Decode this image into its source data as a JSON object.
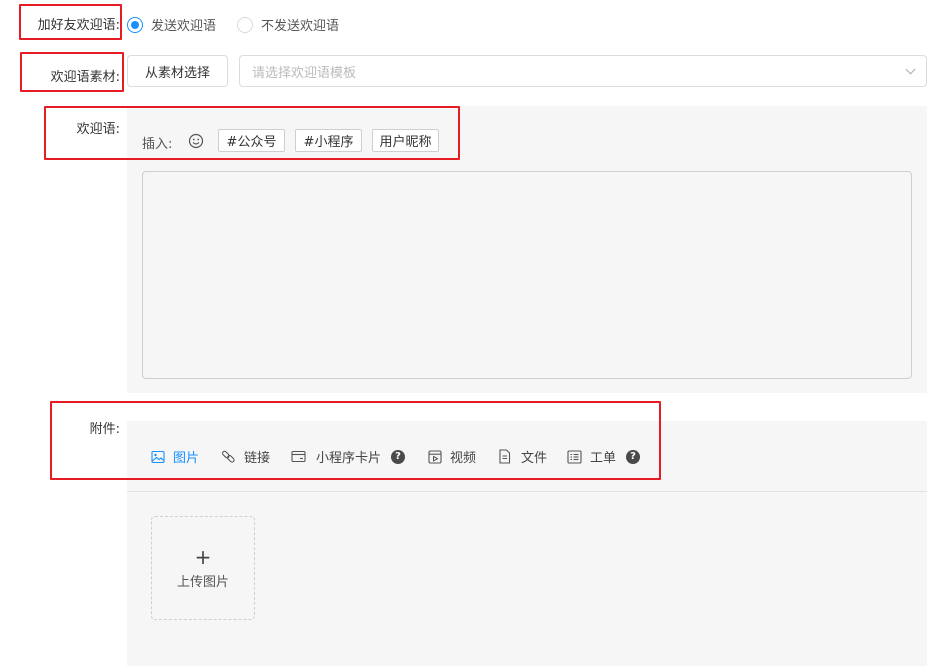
{
  "form": {
    "welcome_toggle": {
      "label": "加好友欢迎语:",
      "options": [
        "发送欢迎语",
        "不发送欢迎语"
      ],
      "selected": "发送欢迎语"
    },
    "material": {
      "label": "欢迎语素材:",
      "pick_button": "从素材选择",
      "select_placeholder": "请选择欢迎语模板"
    },
    "welcome_text": {
      "label": "欢迎语:",
      "insert_label": "插入:",
      "tags": [
        "#公众号",
        "#小程序",
        "用户昵称"
      ],
      "value": ""
    },
    "attachments": {
      "label": "附件:",
      "items": [
        {
          "label": "图片",
          "icon": "image-icon",
          "active": true
        },
        {
          "label": "链接",
          "icon": "link-icon",
          "active": false
        },
        {
          "label": "小程序卡片",
          "icon": "card-icon",
          "active": false,
          "help": true
        },
        {
          "label": "视频",
          "icon": "video-icon",
          "active": false
        },
        {
          "label": "文件",
          "icon": "file-icon",
          "active": false
        },
        {
          "label": "工单",
          "icon": "list-icon",
          "active": false,
          "help": true
        }
      ],
      "upload_label": "上传图片"
    }
  },
  "colors": {
    "accent": "#1890ff",
    "highlight_box": "#e51c23",
    "panel_bg": "#f6f6f6"
  }
}
